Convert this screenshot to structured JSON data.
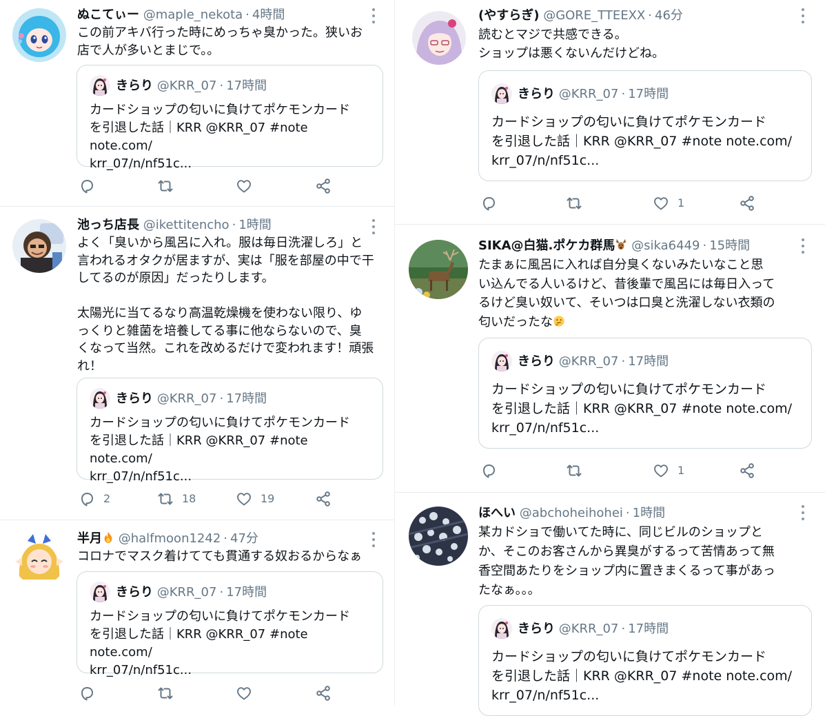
{
  "quoted": {
    "name": "きらり",
    "handle": "@KRR_07",
    "time": "17時間",
    "text": "カードショップの匂いに負けてポケモンカード\nを引退した話｜KRR @KRR_07 #note note.com/\nkrr_07/n/nf51c..."
  },
  "tweets": [
    {
      "name": "ぬこてぃー",
      "handle": "@maple_nekota",
      "time": "4時間",
      "text": "この前アキバ行った時にめっちゃ臭かった。狭いお\n店で人が多いとまじで。。",
      "reply": "",
      "retweet": "",
      "like": ""
    },
    {
      "name": "池っち店長",
      "handle": "@ikettitencho",
      "time": "1時間",
      "text": "よく「臭いから風呂に入れ。服は毎日洗濯しろ」と\n言われるオタクが居ますが、実は「服を部屋の中で干\nしてるのが原因」だったりします。\n\n太陽光に当てるなり高温乾燥機を使わない限り、ゆ\nっくりと雑菌を培養してる事に他ならないので、臭\nくなって当然。これを改めるだけで変われます！頑張\nれ！",
      "reply": "2",
      "retweet": "18",
      "like": "19"
    },
    {
      "name": "半月",
      "handle": "@halfmoon1242",
      "time": "47分",
      "text": "コロナでマスク着けてても貫通する奴おるからなぁ",
      "reply": "",
      "retweet": "",
      "like": ""
    },
    {
      "name": "(やすらぎ)",
      "handle": "@GORE_TTEEXX",
      "time": "46分",
      "text": "読むとマジで共感できる。\nショップは悪くないんだけどね。",
      "reply": "",
      "retweet": "",
      "like": "1"
    },
    {
      "name": "SIKA@白猫.ポケカ群馬",
      "handle": "@sika6449",
      "time": "15時間",
      "text": "たまぁに風呂に入れば自分臭くないみたいなこと思\nい込んでる人いるけど、昔後輩で風呂には毎日入って\nるけど臭い奴いて、そいつは口臭と洗濯しない衣類の\n匂いだったな",
      "reply": "",
      "retweet": "",
      "like": "1"
    },
    {
      "name": "ほへい",
      "handle": "@abchoheihohei",
      "time": "1時間",
      "text": "某カドショで働いてた時に、同じビルのショップと\nか、そこのお客さんから異臭がするって苦情あって無\n香空間あたりをショップ内に置きまくるって事があっ\nたなぁ。。。",
      "reply": "",
      "retweet": "",
      "like": ""
    }
  ],
  "icons": {
    "reply": "reply-icon",
    "retweet": "retweet-icon",
    "like": "heart-icon",
    "share": "share-icon",
    "menu": "more-vertical-icon"
  },
  "colors": {
    "text": "#0f1419",
    "secondary": "#657786",
    "border": "#cfd9de",
    "divider": "#e6ecf0",
    "background": "#ffffff"
  }
}
